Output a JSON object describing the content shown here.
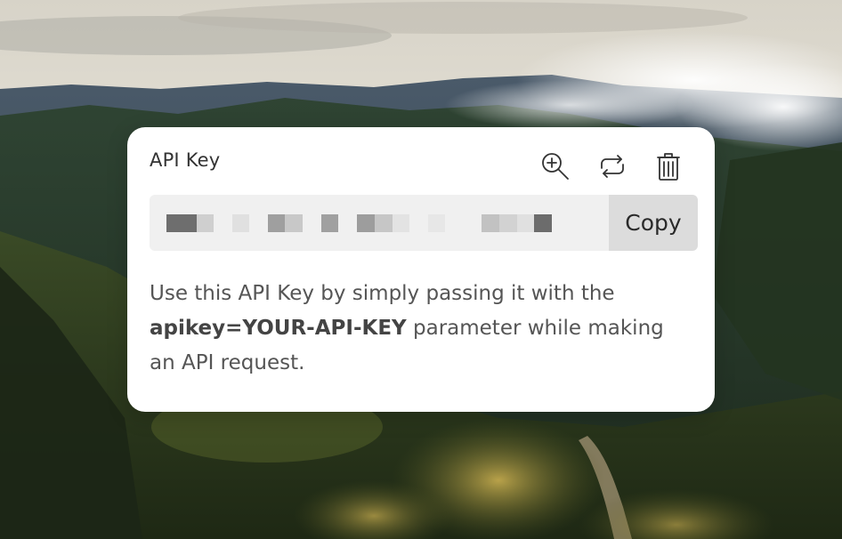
{
  "card": {
    "title": "API Key",
    "actions": {
      "zoom_icon": "zoom-in-icon",
      "refresh_icon": "refresh-icon",
      "delete_icon": "trash-icon"
    },
    "key_value_masked": true,
    "copy_label": "Copy",
    "help": {
      "prefix": "Use this API Key by simply passing it with the ",
      "code": "apikey=YOUR-API-KEY",
      "suffix": " parameter while making an API request."
    }
  },
  "colors": {
    "card_background": "#ffffff",
    "field_background": "#f0f0f0",
    "copy_button_background": "#dcdcdc",
    "text_primary": "#333333",
    "text_secondary": "#555555"
  }
}
